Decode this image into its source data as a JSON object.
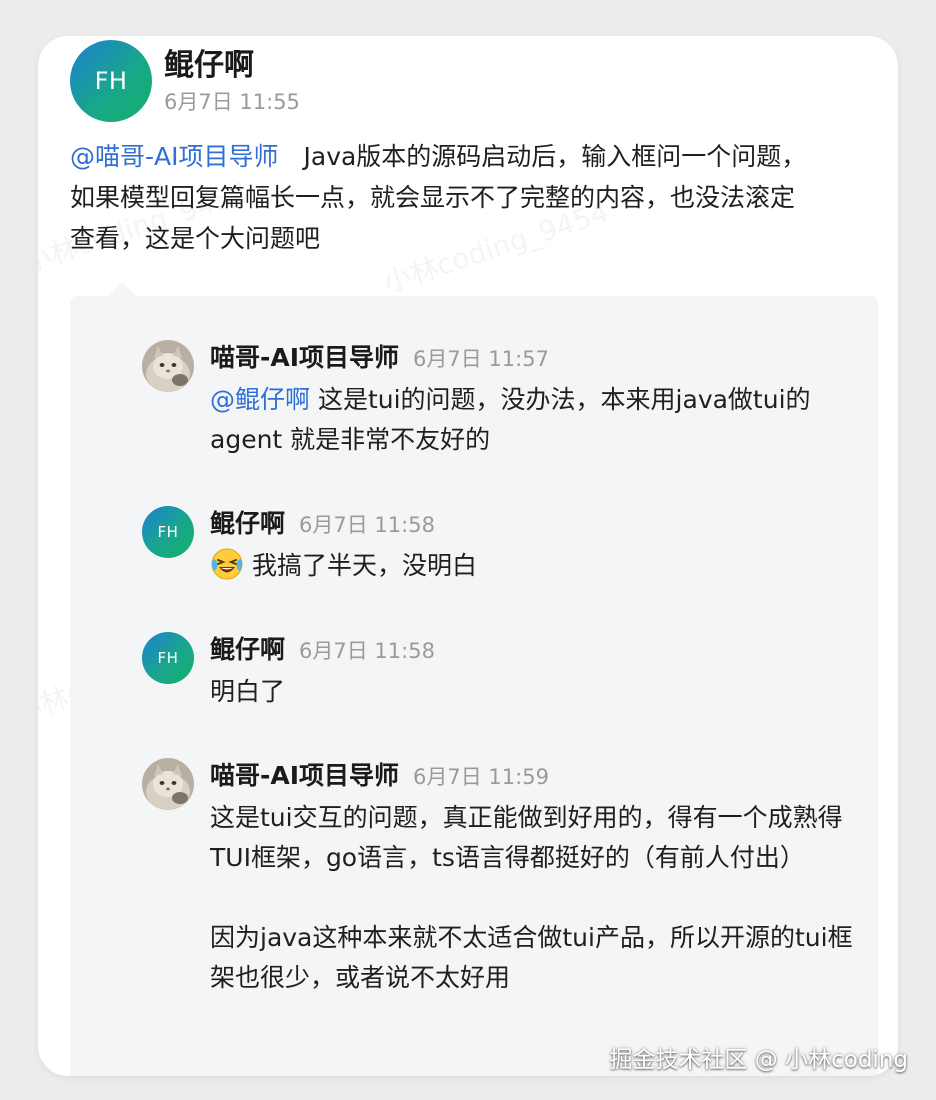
{
  "main_post": {
    "avatar_initials": "FH",
    "author": "鲲仔啊",
    "time": "6月7日 11:55",
    "mention": "@喵哥-AI项目导师",
    "text": "　Java版本的源码启动后，输入框问一个问题，如果模型回复篇幅长一点，就会显示不了完整的内容，也没法滚定查看，这是个大问题吧"
  },
  "replies": [
    {
      "avatar": "cat-photo",
      "author": "喵哥-AI项目导师",
      "time": "6月7日 11:57",
      "mention": "@鲲仔啊",
      "text": " 这是tui的问题，没办法，本来用java做tui的agent 就是非常不友好的"
    },
    {
      "avatar_initials": "FH",
      "author": "鲲仔啊",
      "time": "6月7日 11:58",
      "emoji": "crying-laughing-face",
      "text": "我搞了半天，没明白"
    },
    {
      "avatar_initials": "FH",
      "author": "鲲仔啊",
      "time": "6月7日 11:58",
      "text": "明白了"
    },
    {
      "avatar": "cat-photo",
      "author": "喵哥-AI项目导师",
      "time": "6月7日 11:59",
      "text_p1": "这是tui交互的问题，真正能做到好用的，得有一个成熟得TUI框架，go语言，ts语言得都挺好的（有前人付出）",
      "text_p2": "因为java这种本来就不太适合做tui产品，所以开源的tui框架也很少，或者说不太好用"
    }
  ],
  "watermark": {
    "text": "小林coding_9454"
  },
  "footer": {
    "text": "掘金技术社区 @ 小林coding"
  },
  "colors": {
    "mention": "#2f6fd6",
    "avatar_gradient_start": "#1d7fd6",
    "avatar_gradient_end": "#13b06a",
    "reply_background": "#f4f5f7"
  }
}
